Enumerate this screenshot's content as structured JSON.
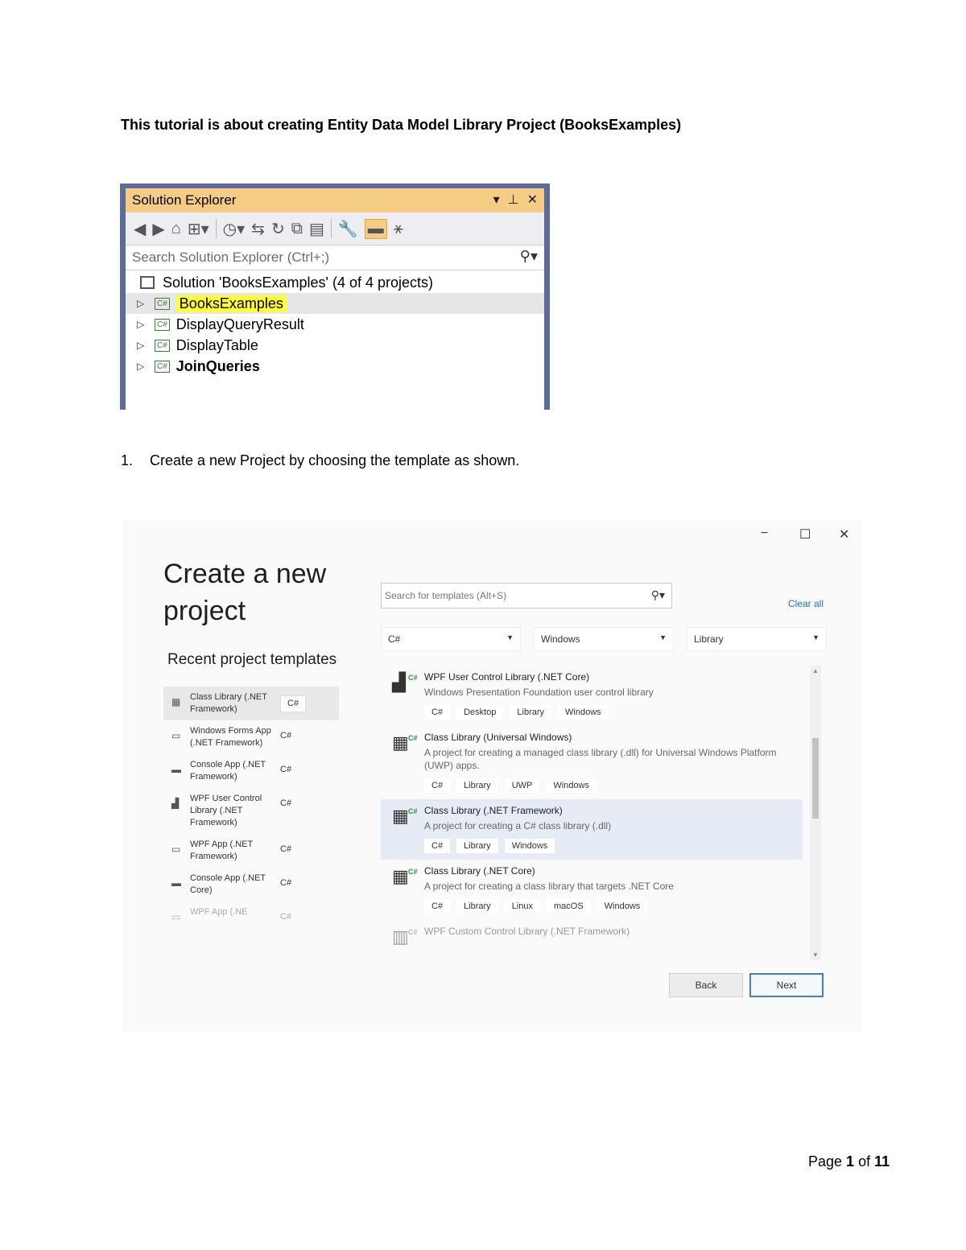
{
  "doc": {
    "heading": "This tutorial is about creating Entity Data Model Library Project (BooksExamples)",
    "step1_number": "1.",
    "step1_text": "Create a new Project by choosing the template as shown.",
    "footer_prefix": "Page ",
    "footer_page": "1",
    "footer_mid": " of ",
    "footer_total": "11"
  },
  "solution_explorer": {
    "title": "Solution Explorer",
    "search_placeholder": "Search Solution Explorer (Ctrl+;)",
    "solution_label": "Solution 'BooksExamples' (4 of 4 projects)",
    "projects": [
      "BooksExamples",
      "DisplayQueryResult",
      "DisplayTable",
      "JoinQueries"
    ],
    "highlight_color": "#ffff33",
    "title_color": "#f5cc84",
    "frame_color": "#5d6b99"
  },
  "dialog": {
    "title": "Create a new project",
    "recent_heading": "Recent project templates",
    "search_placeholder": "Search for templates (Alt+S)",
    "clear_all": "Clear all",
    "filters": [
      "C#",
      "Windows",
      "Library"
    ],
    "recent": [
      {
        "name": "Class Library (.NET Framework)",
        "lang": "C#"
      },
      {
        "name": "Windows Forms App (.NET Framework)",
        "lang": "C#"
      },
      {
        "name": "Console App (.NET Framework)",
        "lang": "C#"
      },
      {
        "name": "WPF User Control Library (.NET Framework)",
        "lang": "C#"
      },
      {
        "name": "WPF App (.NET Framework)",
        "lang": "C#"
      },
      {
        "name": "Console App (.NET Core)",
        "lang": "C#"
      },
      {
        "name": "WPF App (.NE",
        "lang": "C#"
      }
    ],
    "templates": [
      {
        "name": "WPF User Control Library (.NET Core)",
        "desc": "Windows Presentation Foundation user control library",
        "tags": [
          "C#",
          "Desktop",
          "Library",
          "Windows"
        ]
      },
      {
        "name": "Class Library (Universal Windows)",
        "desc": "A project for creating a managed class library (.dll) for Universal Windows Platform (UWP) apps.",
        "tags": [
          "C#",
          "Library",
          "UWP",
          "Windows"
        ]
      },
      {
        "name": "Class Library (.NET Framework)",
        "desc": "A project for creating a C# class library (.dll)",
        "tags": [
          "C#",
          "Library",
          "Windows"
        ]
      },
      {
        "name": "Class Library (.NET Core)",
        "desc": "A project for creating a class library that targets .NET Core",
        "tags": [
          "C#",
          "Library",
          "Linux",
          "macOS",
          "Windows"
        ]
      },
      {
        "name": "WPF Custom Control Library (.NET Framework)",
        "desc": "",
        "tags": []
      }
    ],
    "back_label": "Back",
    "next_label": "Next",
    "accent_color": "#3c7fd6"
  }
}
